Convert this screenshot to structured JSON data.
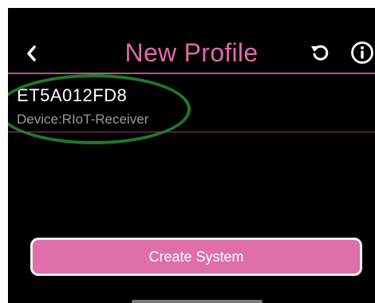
{
  "header": {
    "title": "New Profile",
    "back_icon": "chevron-left-icon",
    "refresh_icon": "refresh-icon",
    "info_icon": "info-icon"
  },
  "device": {
    "id": "ET5A012FD8",
    "subtitle": "Device:RIoT-Receiver"
  },
  "actions": {
    "create_label": "Create System"
  },
  "colors": {
    "accent": "#e06aa8",
    "button": "#de6fa9",
    "background": "#000000",
    "highlight": "#1e7a28"
  }
}
